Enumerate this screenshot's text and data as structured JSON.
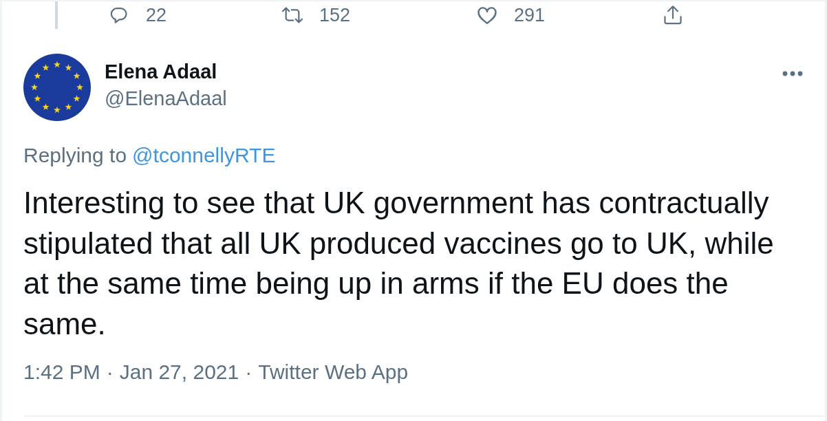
{
  "actions": [
    {
      "kind": "reply",
      "count": "22"
    },
    {
      "kind": "retweet",
      "count": "152"
    },
    {
      "kind": "like",
      "count": "291"
    },
    {
      "kind": "share"
    }
  ],
  "tweet": {
    "author": {
      "name": "Elena Adaal",
      "handle": "@ElenaAdaal"
    },
    "reply_prefix": "Replying to",
    "reply_to": "@tconnellyRTE",
    "text": "Interesting to see that UK government has contractually stipulated that all UK produced vaccines go to UK, while at the same time being up in arms if the EU does the same.",
    "meta": {
      "items": [
        "1:42 PM",
        "Jan 27, 2021",
        "Twitter Web App"
      ],
      "separator": "·"
    }
  }
}
